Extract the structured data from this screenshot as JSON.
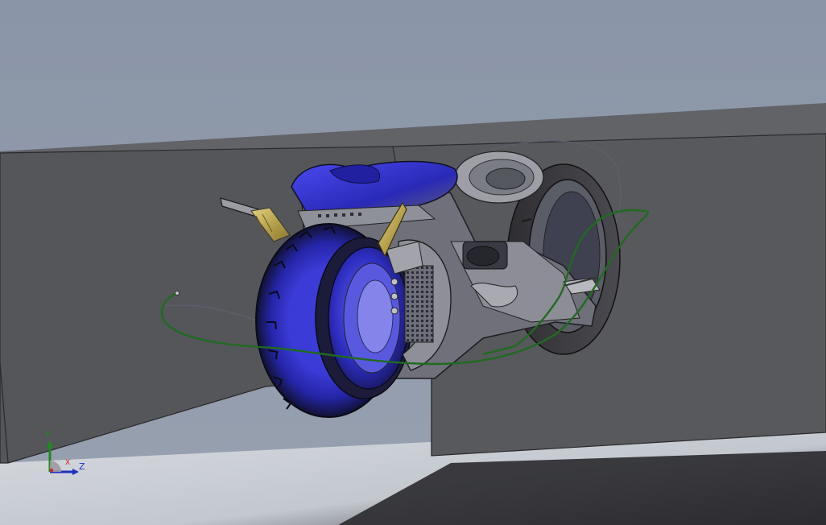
{
  "viewport": {
    "model_name": "tron-style-lightcycle",
    "background_top_color": "#8b96a8",
    "floor_color": "#c6cbd2",
    "wall_color": "#545557",
    "body_accent_color": "#3a3ae6",
    "path_curve_color": "#1f6b1f",
    "bolt_color": "#c9b24a"
  },
  "triad": {
    "y_label": "Y",
    "x_label": "X",
    "z_label": "Z",
    "y_color": "#1c8a1c",
    "x_color": "#d02020",
    "z_color": "#2030c0"
  }
}
